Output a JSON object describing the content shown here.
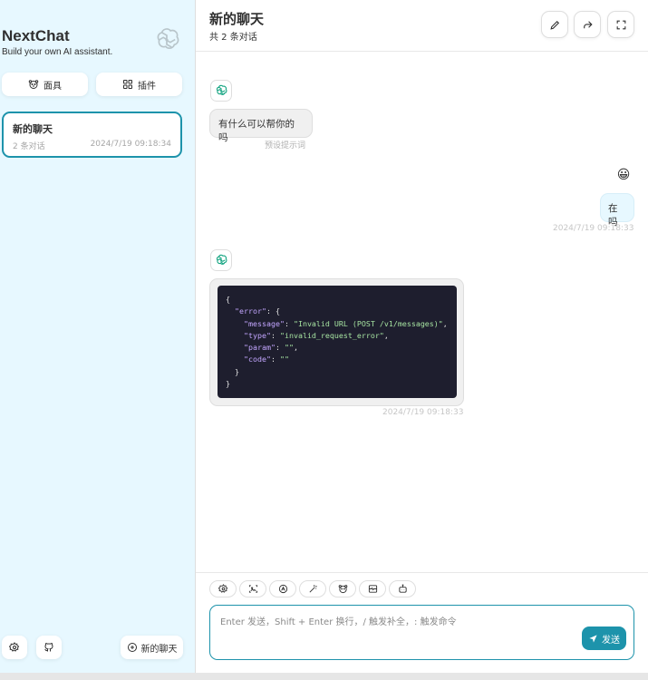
{
  "sidebar": {
    "app_title": "NextChat",
    "app_subtitle": "Build your own AI assistant.",
    "mask_label": "面具",
    "plugin_label": "插件",
    "chats": [
      {
        "title": "新的聊天",
        "count": "2 条对话",
        "date": "2024/7/19 09:18:34"
      }
    ],
    "new_chat_label": "新的聊天"
  },
  "header": {
    "title": "新的聊天",
    "subtitle": "共 2 条对话"
  },
  "messages": {
    "bot_greeting": "有什么可以帮你的吗",
    "bot_greeting_hint": "预设提示词",
    "user_emoji": "😀",
    "user_text": "在吗",
    "user_time": "2024/7/19 09:18:33",
    "bot_error_time": "2024/7/19 09:18:33",
    "code": {
      "l1": "{",
      "l2_key": "\"error\"",
      "l2_rest": ": {",
      "l3_key": "\"message\"",
      "l3_val": "\"Invalid URL (POST /v1/messages)\"",
      "l4_key": "\"type\"",
      "l4_val": "\"invalid_request_error\"",
      "l5_key": "\"param\"",
      "l5_val": "\"\"",
      "l6_key": "\"code\"",
      "l6_val": "\"\"",
      "l7": "}",
      "l8": "}"
    }
  },
  "composer": {
    "placeholder": "Enter 发送，Shift + Enter 换行，/ 触发补全，: 触发命令",
    "send_label": "发送"
  },
  "colors": {
    "accent": "#1d93ab",
    "sidebar_bg": "#e7f8ff",
    "code_bg": "#1e1e2e"
  }
}
